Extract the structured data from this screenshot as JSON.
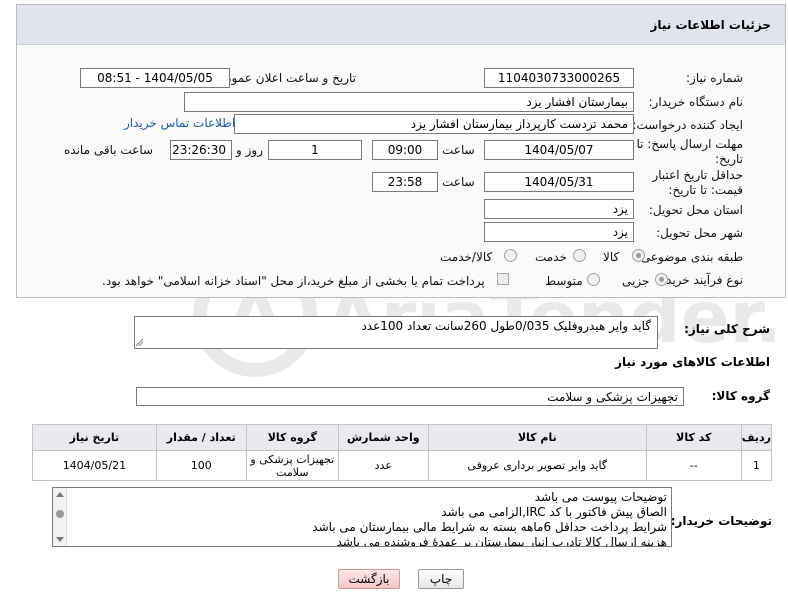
{
  "panel": {
    "title": "جزئیات اطلاعات نیاز"
  },
  "fields": {
    "need_number_label": "شماره نیاز:",
    "need_number": "1104030733000265",
    "announce_label": "تاریخ و ساعت اعلان عمومی:",
    "announce_value": "1404/05/05 - 08:51",
    "buyer_org_label": "نام دستگاه خریدار:",
    "buyer_org": "بیمارستان افشار یزد",
    "creator_label": "ایجاد کننده درخواست:",
    "creator": "محمد تردست کارپرداز بیمارستان افشار یزد",
    "contact_link": "اطلاعات تماس خریدار",
    "deadline_label": "مهلت ارسال پاسخ: تا تاریخ:",
    "deadline_date": "1404/05/07",
    "time_label": "ساعت",
    "deadline_time": "09:00",
    "days_value": "1",
    "days_label": "روز و",
    "remaining_time": "23:26:30",
    "remaining_label": "ساعت باقی مانده",
    "price_validity_label": "حداقل تاریخ اعتبار قیمت: تا تاریخ:",
    "price_validity_date": "1404/05/31",
    "price_validity_time": "23:58",
    "province_label": "استان محل تحویل:",
    "province": "یزد",
    "city_label": "شهر محل تحویل:",
    "city": "یزد",
    "category_label": "طبقه بندی موضوعی:",
    "category_options": [
      "کالا",
      "خدمت",
      "کالا/خدمت"
    ],
    "category_selected": "کالا",
    "process_label": "نوع فرآیند خرید :",
    "process_options": [
      "جزیی",
      "متوسط"
    ],
    "process_selected": "جزیی",
    "treasury_note": "پرداخت تمام یا بخشی از مبلغ خرید،از محل \"اسناد خزانه اسلامی\" خواهد بود."
  },
  "general_desc": {
    "label": "شرح کلی نیاز:",
    "value": "گاید وایر هیدروفلیک 0/035طول 260سانت تعداد 100عدد"
  },
  "goods_info": {
    "title": "اطلاعات کالاهای مورد نیاز",
    "group_label": "گروه کالا:",
    "group_value": "تجهیزات پزشکی و سلامت"
  },
  "table": {
    "headers": [
      "ردیف",
      "کد کالا",
      "نام کالا",
      "واحد شمارش",
      "گروه کالا",
      "تعداد / مقدار",
      "تاریخ نیاز"
    ],
    "rows": [
      [
        "1",
        "--",
        "گاید وایر تصویر برداری عروقی",
        "عدد",
        "تجهیزات پزشکی و سلامت",
        "100",
        "1404/05/21"
      ]
    ]
  },
  "buyer_notes": {
    "label": "توضیحات خریدار:",
    "lines": [
      "توضیحات پیوست می باشد",
      "الصاق پیش فاکتور با کد IRC,الزامی می باشد",
      "شرایط پرداخت حداقل 6ماهه بسته به شرایط مالی بیمارستان می باشد",
      "هزینه ارسال کالا تادرب انبار بیمارستان بر عهدهٔ فروشنده می باشد"
    ]
  },
  "buttons": {
    "print": "چاپ",
    "back": "بازگشت"
  },
  "watermark": {
    "text": "AriaTender.net"
  }
}
